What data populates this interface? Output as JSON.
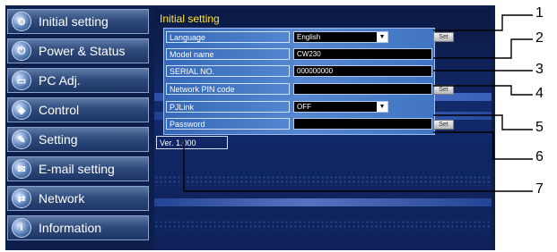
{
  "sidebar": {
    "items": [
      {
        "label": "Initial setting",
        "icon": "gear-icon",
        "glyph": "⚙"
      },
      {
        "label": "Power & Status",
        "icon": "power-icon",
        "glyph": "⏻"
      },
      {
        "label": "PC Adj.",
        "icon": "monitor-icon",
        "glyph": "▭"
      },
      {
        "label": "Control",
        "icon": "control-icon",
        "glyph": "◈"
      },
      {
        "label": "Setting",
        "icon": "settings-icon",
        "glyph": "✎"
      },
      {
        "label": "E-mail setting",
        "icon": "mail-icon",
        "glyph": "✉"
      },
      {
        "label": "Network",
        "icon": "network-icon",
        "glyph": "⇄"
      },
      {
        "label": "Information",
        "icon": "info-icon",
        "glyph": "i"
      }
    ]
  },
  "main": {
    "title": "Initial setting",
    "rows": [
      {
        "label": "Language",
        "value": "English",
        "type": "select",
        "set": "Set"
      },
      {
        "label": "Model name",
        "value": "CW230",
        "type": "text"
      },
      {
        "label": "SERIAL NO.",
        "value": "000000000",
        "type": "text"
      },
      {
        "label": "Network PIN code",
        "value": "",
        "type": "input",
        "set": "Set"
      },
      {
        "label": "PJLink",
        "value": "OFF",
        "type": "select"
      },
      {
        "label": "Password",
        "value": "",
        "type": "input",
        "set": "Set"
      }
    ],
    "version": "Ver. 1.000"
  },
  "callouts": [
    "1",
    "2",
    "3",
    "4",
    "5",
    "6",
    "7"
  ],
  "colors": {
    "title": "#ffe23a",
    "frame": "#0d1e4a",
    "form": "#4a7cc8"
  }
}
